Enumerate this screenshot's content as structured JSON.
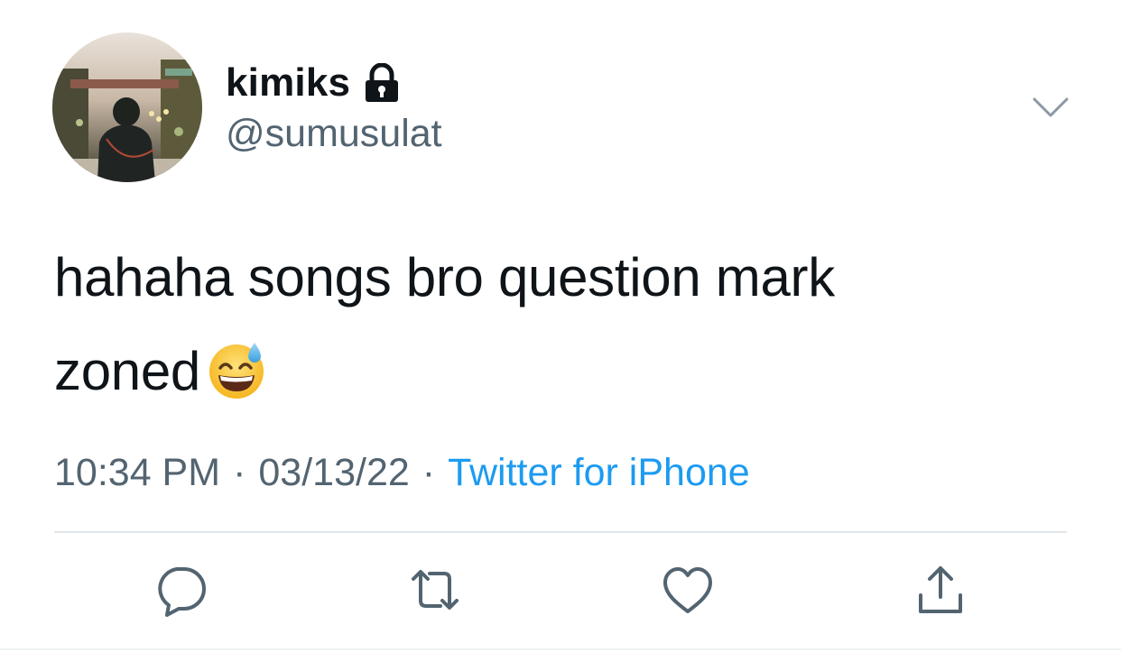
{
  "tweet": {
    "author": {
      "display_name": "kimiks",
      "handle": "@sumusulat",
      "protected_icon": "lock-icon",
      "avatar_icon": "avatar-photo"
    },
    "menu_icon": "chevron-down-icon",
    "text_line1": "hahaha songs bro question mark",
    "text_line2": "zoned",
    "emoji": "grinning-face-with-sweat",
    "time": "10:34 PM",
    "separator": "·",
    "date": "03/13/22",
    "source": "Twitter for iPhone"
  },
  "actions": [
    {
      "icon": "reply-icon"
    },
    {
      "icon": "retweet-icon"
    },
    {
      "icon": "like-icon"
    },
    {
      "icon": "share-icon"
    }
  ],
  "colors": {
    "text": "#0f1419",
    "secondary": "#536471",
    "link": "#1d9bf0",
    "divider": "#e1e6ea"
  }
}
